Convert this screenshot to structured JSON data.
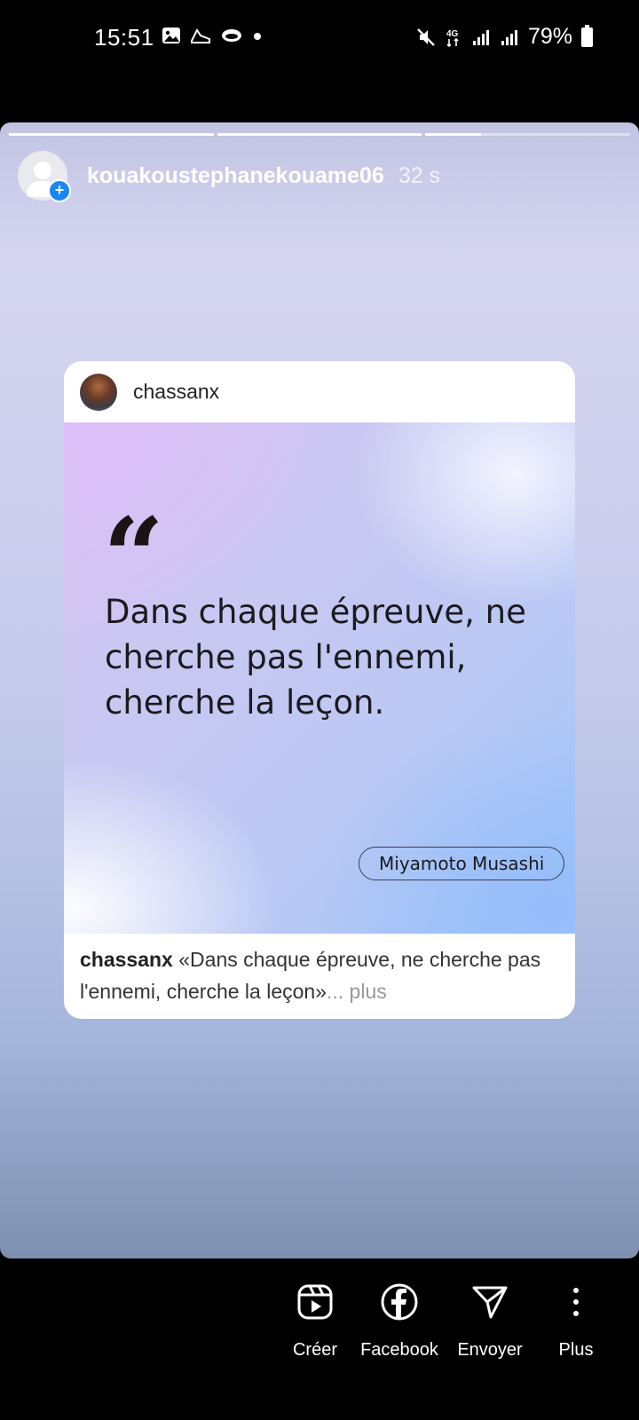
{
  "status_bar": {
    "time": "15:51",
    "battery": "79%",
    "network": "4G"
  },
  "story": {
    "username": "kouakoustephanekouame06",
    "time_ago": "32 s",
    "progress": [
      1.0,
      1.0,
      0.27
    ]
  },
  "post": {
    "username": "chassanx",
    "image": {
      "quote_mark": "“",
      "quote_line1": "Dans chaque épreuve, ne",
      "quote_line2": "cherche pas l'ennemi,",
      "quote_line3": "cherche la leçon.",
      "author": "Miyamoto Musashi"
    },
    "caption": {
      "user": "chassanx",
      "text": " «Dans chaque épreuve, ne cherche pas l'ennemi, cherche la leçon»",
      "more": "... plus"
    }
  },
  "actions": {
    "create_label": "Créer",
    "facebook_label": "Facebook",
    "send_label": "Envoyer",
    "more_label": "Plus"
  }
}
